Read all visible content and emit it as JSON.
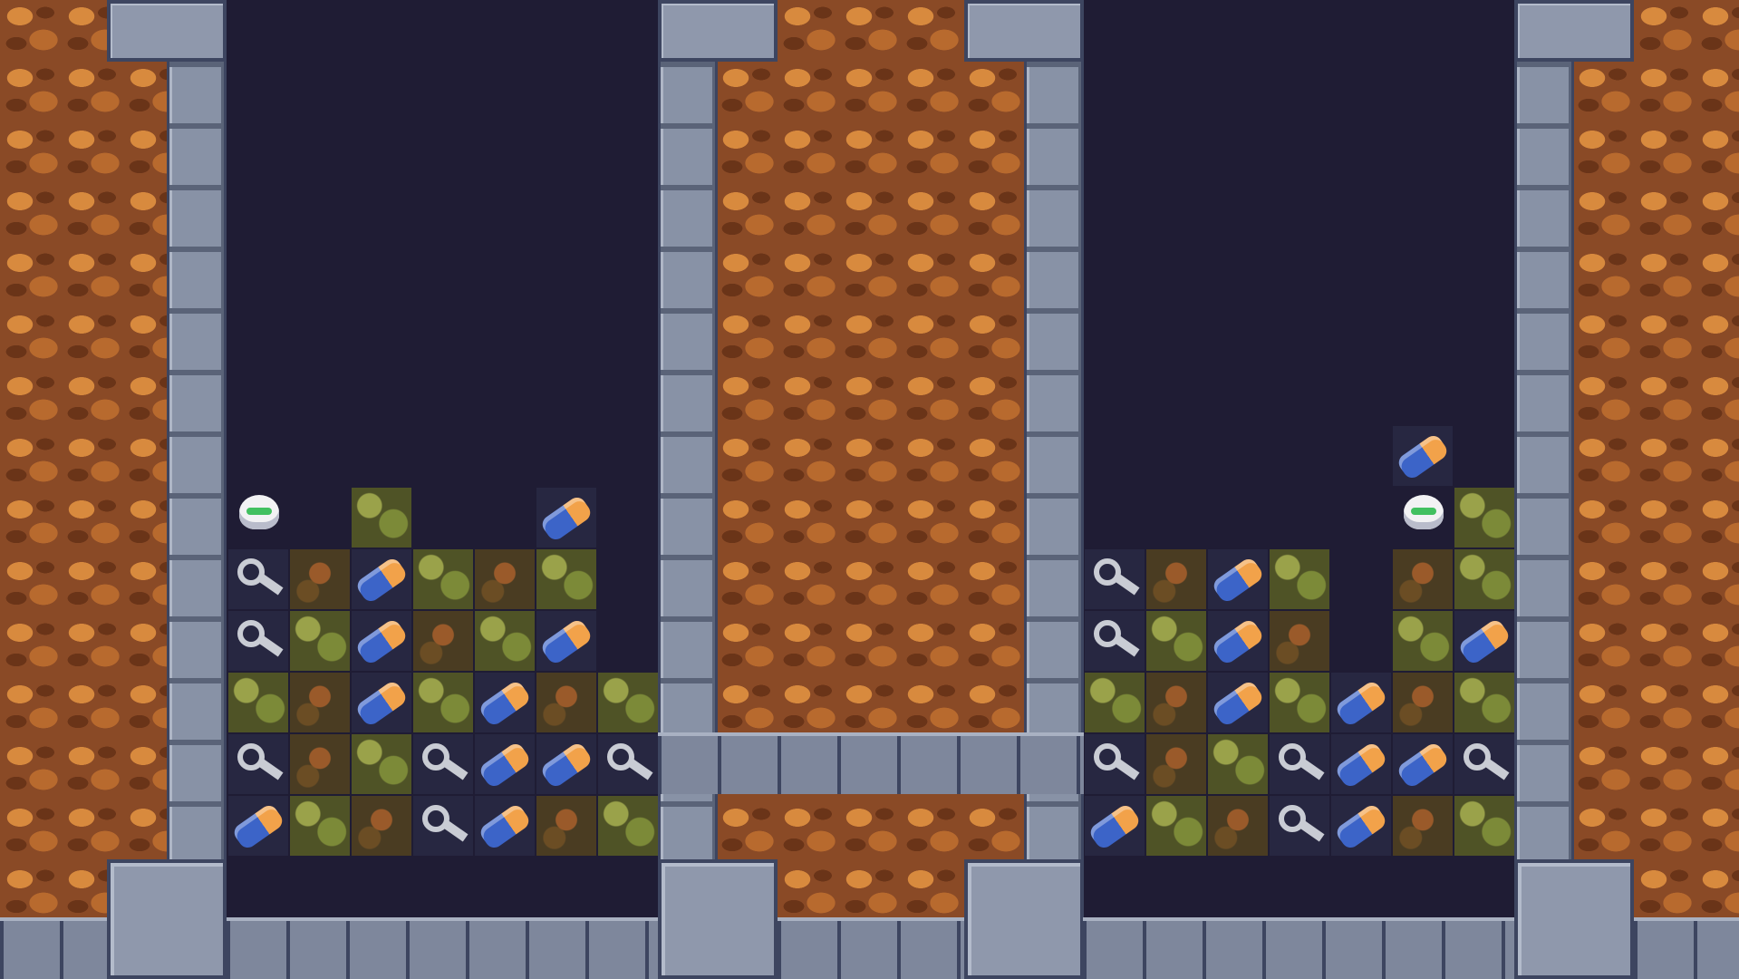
{
  "scene": {
    "name": "puzzle-game-two-wells",
    "columns": [
      {
        "id": "left-well",
        "rows": [
          [
            "",
            "",
            "",
            "",
            "",
            "",
            ""
          ],
          [
            "",
            "",
            "",
            "",
            "",
            "",
            ""
          ],
          [
            "robot",
            "",
            "moss",
            "",
            "",
            "battery",
            ""
          ],
          [
            "gear",
            "dirt",
            "battery",
            "moss",
            "dirt",
            "moss",
            ""
          ],
          [
            "gear",
            "moss",
            "battery",
            "dirt",
            "moss",
            "battery",
            ""
          ],
          [
            "moss",
            "dirt",
            "battery",
            "moss",
            "battery",
            "dirt",
            "moss"
          ],
          [
            "gear",
            "dirt",
            "moss",
            "gear",
            "battery",
            "battery",
            "gear"
          ],
          [
            "battery",
            "moss",
            "dirt",
            "gear",
            "battery",
            "dirt",
            "moss"
          ]
        ]
      },
      {
        "id": "right-well",
        "rows": [
          [
            "",
            "",
            "",
            "",
            "",
            "battery",
            ""
          ],
          [
            "",
            "",
            "",
            "",
            "",
            "robot",
            "moss"
          ],
          [
            "gear",
            "dirt",
            "battery",
            "moss",
            "",
            "dirt",
            "moss"
          ],
          [
            "gear",
            "moss",
            "battery",
            "dirt",
            "",
            "moss",
            "battery"
          ],
          [
            "moss",
            "dirt",
            "battery",
            "moss",
            "battery",
            "dirt",
            "moss"
          ],
          [
            "gear",
            "dirt",
            "moss",
            "gear",
            "battery",
            "battery",
            "gear"
          ],
          [
            "battery",
            "moss",
            "dirt",
            "gear",
            "battery",
            "dirt",
            "moss"
          ]
        ]
      }
    ]
  }
}
